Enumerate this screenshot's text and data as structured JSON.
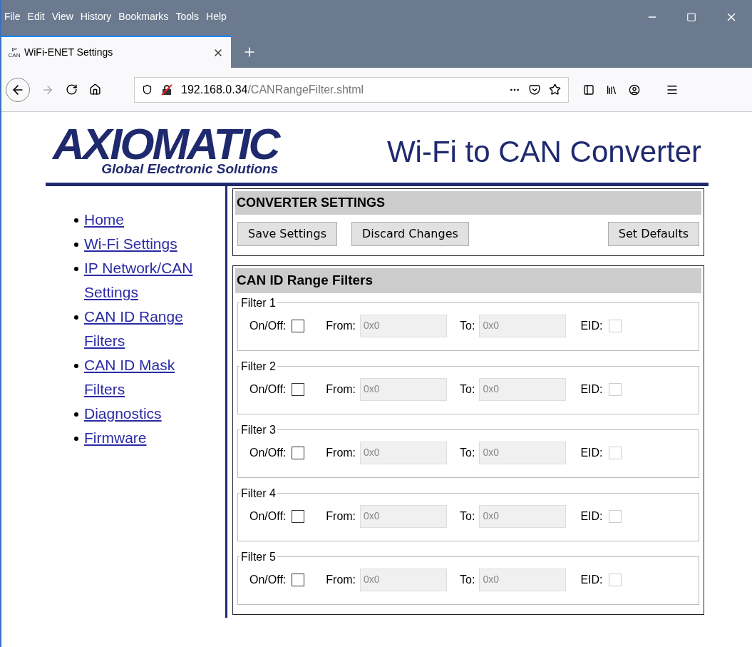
{
  "menu_bar": [
    "File",
    "Edit",
    "View",
    "History",
    "Bookmarks",
    "Tools",
    "Help"
  ],
  "tab": {
    "title": "WiFi-ENET Settings",
    "icon_text_top": "IP",
    "icon_text_bottom": "CAN"
  },
  "address_bar": {
    "host": "192.168.0.34",
    "path": "/CANRangeFilter.shtml"
  },
  "header": {
    "logo": "AXIOMATIC",
    "tagline": "Global Electronic Solutions",
    "title": "Wi-Fi to CAN Converter"
  },
  "nav": [
    "Home",
    "Wi-Fi Settings",
    "IP Network/CAN Settings",
    "CAN ID Range Filters",
    "CAN ID Mask Filters",
    "Diagnostics",
    "Firmware"
  ],
  "converter_settings": {
    "title": "CONVERTER SETTINGS",
    "buttons": [
      "Save Settings",
      "Discard Changes",
      "Set Defaults"
    ]
  },
  "range_filters": {
    "title": "CAN ID Range Filters",
    "filters": [
      {
        "legend": "Filter 1",
        "on_label": "On/Off:",
        "on": false,
        "from_label": "From:",
        "from": "0x0",
        "to_label": "To:",
        "to": "0x0",
        "eid_label": "EID:",
        "eid": false,
        "disabled": true
      },
      {
        "legend": "Filter 2",
        "on_label": "On/Off:",
        "on": false,
        "from_label": "From:",
        "from": "0x0",
        "to_label": "To:",
        "to": "0x0",
        "eid_label": "EID:",
        "eid": false,
        "disabled": true
      },
      {
        "legend": "Filter 3",
        "on_label": "On/Off:",
        "on": false,
        "from_label": "From:",
        "from": "0x0",
        "to_label": "To:",
        "to": "0x0",
        "eid_label": "EID:",
        "eid": false,
        "disabled": true
      },
      {
        "legend": "Filter 4",
        "on_label": "On/Off:",
        "on": false,
        "from_label": "From:",
        "from": "0x0",
        "to_label": "To:",
        "to": "0x0",
        "eid_label": "EID:",
        "eid": false,
        "disabled": true
      },
      {
        "legend": "Filter 5",
        "on_label": "On/Off:",
        "on": false,
        "from_label": "From:",
        "from": "0x0",
        "to_label": "To:",
        "to": "0x0",
        "eid_label": "EID:",
        "eid": false,
        "disabled": true
      }
    ]
  }
}
